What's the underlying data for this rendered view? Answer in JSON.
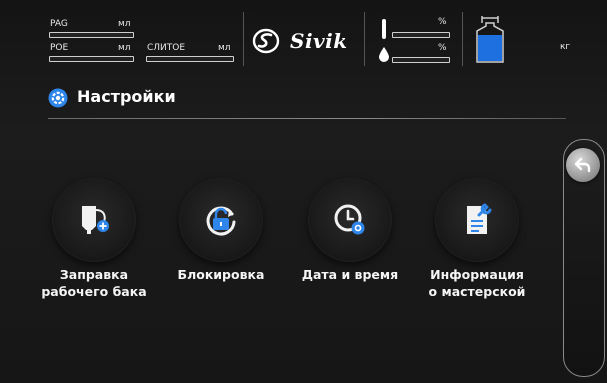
{
  "status": {
    "pag_label": "PAG",
    "pag_unit": "мл",
    "pag_level": 0,
    "poe_label": "POE",
    "poe_unit": "мл",
    "poe_level": 0,
    "drain_label": "СЛИТОЕ",
    "drain_unit": "мл",
    "drain_level": 0,
    "temp_unit": "%",
    "temp_level": 0,
    "humidity_unit": "%",
    "humidity_level": 0,
    "tank_unit": "кг",
    "logo": "Sivik",
    "accent": "#1e7be6"
  },
  "header": {
    "icon": "gear-icon",
    "title": "Настройки"
  },
  "tiles": [
    {
      "label": "Заправка\nрабочего бака",
      "icon": "tank-fill-icon"
    },
    {
      "label": "Блокировка",
      "icon": "unlock-icon"
    },
    {
      "label": "Дата и время",
      "icon": "clock-icon"
    },
    {
      "label": "Информация\nо мастерской",
      "icon": "document-wrench-icon"
    }
  ],
  "side": {
    "back_icon": "back-arrow-icon"
  }
}
